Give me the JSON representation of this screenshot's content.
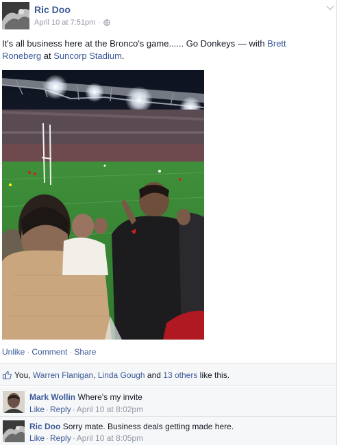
{
  "post": {
    "author": "Ric Doo",
    "timestamp": "April 10 at 7:51pm",
    "meta_separator": "·",
    "privacy_icon": "globe-icon",
    "menu_icon": "chevron-down-icon",
    "text_prefix": "It's all business here at the Bronco's game...... Go Donkeys — with ",
    "tag_person": "Brett Roneberg",
    "text_at": " at ",
    "tag_place": "Suncorp Stadium",
    "text_suffix": "."
  },
  "actions": {
    "unlike": "Unlike",
    "comment": "Comment",
    "share": "Share",
    "separator": "·"
  },
  "likes": {
    "icon": "thumbs-up-icon",
    "you": "You, ",
    "person1": "Warren Flanigan",
    "sep1": ", ",
    "person2": "Linda Gough",
    "and": " and ",
    "others": "13 others",
    "suffix": " like this."
  },
  "comments": [
    {
      "author": "Mark Wollin",
      "text": "Where's my invite",
      "like": "Like",
      "reply": "Reply",
      "time": "April 10 at 8:02pm"
    },
    {
      "author": "Ric Doo",
      "text": "Sorry mate. Business deals getting made here.",
      "like": "Like",
      "reply": "Reply",
      "time": "April 10 at 8:05pm"
    }
  ],
  "colors": {
    "link": "#3b5998",
    "muted": "#9197a3",
    "text": "#141823",
    "panel": "#f6f7f8"
  }
}
